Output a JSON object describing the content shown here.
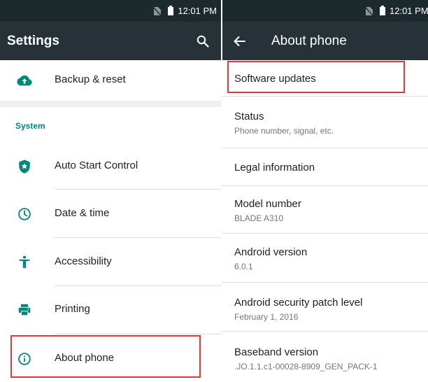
{
  "status_bar": {
    "time": "12:01 PM",
    "time_right": "12:01 PM"
  },
  "settings_screen": {
    "title": "Settings",
    "search_icon": "search-icon",
    "items_top": [
      {
        "label": "Backup & reset",
        "icon": "cloud-upload-icon"
      }
    ],
    "section_header": "System",
    "items_system": [
      {
        "label": "Auto Start Control",
        "icon": "shield-star-icon"
      },
      {
        "label": "Date & time",
        "icon": "clock-icon"
      },
      {
        "label": "Accessibility",
        "icon": "accessibility-icon"
      },
      {
        "label": "Printing",
        "icon": "printer-icon"
      },
      {
        "label": "About phone",
        "icon": "info-icon"
      }
    ]
  },
  "about_screen": {
    "title": "About phone",
    "back_icon": "back-arrow-icon",
    "items": [
      {
        "title": "Software updates",
        "subtitle": ""
      },
      {
        "title": "Status",
        "subtitle": "Phone number, signal, etc."
      },
      {
        "title": "Legal information",
        "subtitle": ""
      },
      {
        "title": "Model number",
        "subtitle": "BLADE A310"
      },
      {
        "title": "Android version",
        "subtitle": "6.0.1"
      },
      {
        "title": "Android security patch level",
        "subtitle": "February 1, 2016"
      },
      {
        "title": "Baseband version",
        "subtitle": ".JO.1.1.c1-00028-8909_GEN_PACK-1"
      }
    ]
  },
  "colors": {
    "status_bar": "#1c2a2d",
    "app_bar": "#263238",
    "accent": "#00897b",
    "highlight": "#e53935"
  }
}
